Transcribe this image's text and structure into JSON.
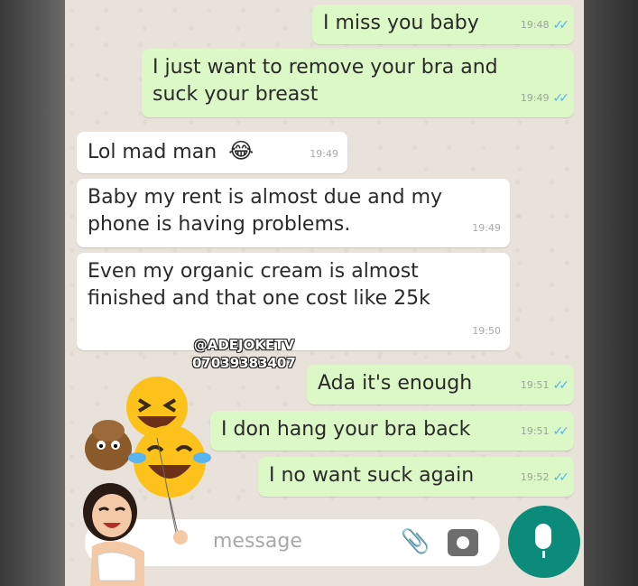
{
  "messages": [
    {
      "text": "I miss you baby",
      "time": "19:48",
      "dir": "out"
    },
    {
      "text": "I just want to remove your bra and suck your breast",
      "time": "19:49",
      "dir": "out"
    },
    {
      "text": "Lol mad man",
      "time": "19:49",
      "dir": "in",
      "emoji": "😂"
    },
    {
      "text": "Baby my rent is almost due and my phone is having problems.",
      "time": "19:49",
      "dir": "in"
    },
    {
      "text": "Even my organic cream is almost finished and that one cost like 25k",
      "time": "19:50",
      "dir": "in"
    },
    {
      "text": "Ada it's enough",
      "time": "19:51",
      "dir": "out"
    },
    {
      "text": "I don hang your bra back",
      "time": "19:51",
      "dir": "out"
    },
    {
      "text": "I no want suck again",
      "time": "19:52",
      "dir": "out"
    }
  ],
  "watermark": {
    "line1": "@ADEJOKETV",
    "line2": "07039383407"
  },
  "input": {
    "placeholder": "message"
  },
  "icons": {
    "attach": "paperclip-icon",
    "camera": "camera-icon",
    "mic": "microphone-icon",
    "read": "double-check-icon"
  },
  "colors": {
    "outgoing": "#dcf8c6",
    "incoming": "#ffffff",
    "chat_bg": "#e9e2db",
    "mic": "#0d8b7a",
    "ticks": "#4fb6ec"
  }
}
